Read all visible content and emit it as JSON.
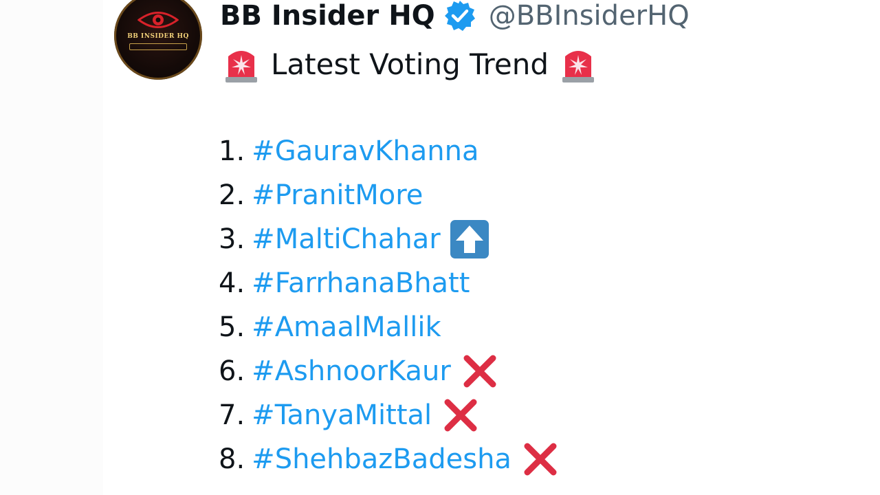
{
  "author": {
    "display_name": "BB Insider HQ",
    "handle": "@BBInsiderHQ",
    "avatar_text": "BB INSIDER HQ",
    "verified": true,
    "avatar_accent": "#c9a24a",
    "verified_color": "#1d9bf0"
  },
  "tweet": {
    "headline": "Latest Voting Trend",
    "headline_icon": "police-siren-icon",
    "hashtag_color": "#1d9bf0",
    "list": [
      {
        "number": "1.",
        "tag": "#GauravKhanna",
        "icon": ""
      },
      {
        "number": "2.",
        "tag": "#PranitMore",
        "icon": ""
      },
      {
        "number": "3.",
        "tag": "#MaltiChahar",
        "icon": "up-arrow-icon"
      },
      {
        "number": "4.",
        "tag": "#FarrhanaBhatt",
        "icon": ""
      },
      {
        "number": "5.",
        "tag": "#AmaalMallik",
        "icon": ""
      },
      {
        "number": "6.",
        "tag": "#AshnoorKaur",
        "icon": "cross-mark-icon"
      },
      {
        "number": "7.",
        "tag": "#TanyaMittal",
        "icon": "cross-mark-icon"
      },
      {
        "number": "8.",
        "tag": "#ShehbazBadesha",
        "icon": "cross-mark-icon"
      }
    ]
  }
}
